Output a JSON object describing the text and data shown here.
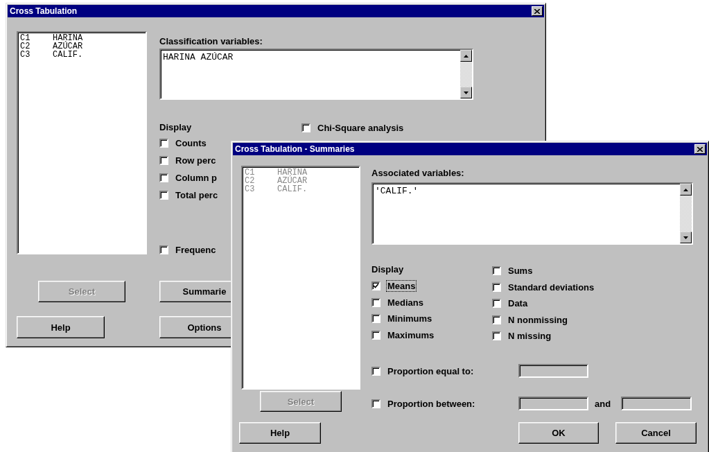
{
  "cross_tabulation": {
    "title": "Cross Tabulation",
    "variables": {
      "disabled": false,
      "items": [
        {
          "column": "C1",
          "name": "HARINA"
        },
        {
          "column": "C2",
          "name": "AZÚCAR"
        },
        {
          "column": "C3",
          "name": "CALIF."
        }
      ]
    },
    "classification_label": "Classification variables:",
    "classification_value": "HARINA AZÚCAR",
    "display_label": "Display",
    "display_options": [
      {
        "label": "Counts",
        "checked": false
      },
      {
        "label": "Row perc",
        "checked": false
      },
      {
        "label": "Column p",
        "checked": false
      },
      {
        "label": "Total perc",
        "checked": false
      }
    ],
    "chi_square": {
      "label": "Chi-Square analysis",
      "checked": false
    },
    "frequencies": {
      "label": "Frequenc",
      "checked": false
    },
    "select_button": {
      "label": "Select",
      "disabled": true
    },
    "help_button": {
      "label": "Help",
      "disabled": false
    },
    "summaries_button": {
      "label": "Summarie",
      "disabled": false
    },
    "options_button": {
      "label": "Options",
      "disabled": false
    }
  },
  "summaries_dialog": {
    "title": "Cross Tabulation - Summaries",
    "variables": {
      "disabled": true,
      "items": [
        {
          "column": "C1",
          "name": "HARINA"
        },
        {
          "column": "C2",
          "name": "AZÚCAR"
        },
        {
          "column": "C3",
          "name": "CALIF."
        }
      ]
    },
    "associated_label": "Associated variables:",
    "associated_value": "'CALIF.'",
    "display_label": "Display",
    "display_left": [
      {
        "label": "Means",
        "checked": true,
        "focused": true
      },
      {
        "label": "Medians",
        "checked": false,
        "focused": false
      },
      {
        "label": "Minimums",
        "checked": false,
        "focused": false
      },
      {
        "label": "Maximums",
        "checked": false,
        "focused": false
      }
    ],
    "display_right": [
      {
        "label": "Sums",
        "checked": false,
        "focused": false
      },
      {
        "label": "Standard deviations",
        "checked": false,
        "focused": false
      },
      {
        "label": "Data",
        "checked": false,
        "focused": false
      },
      {
        "label": "N nonmissing",
        "checked": false,
        "focused": false
      },
      {
        "label": "N missing",
        "checked": false,
        "focused": false
      }
    ],
    "proportion_equal": {
      "label": "Proportion equal to:",
      "checked": false
    },
    "proportion_between": {
      "label": "Proportion between:",
      "checked": false,
      "and_label": "and"
    },
    "select_button": {
      "label": "Select",
      "disabled": true
    },
    "help_button": {
      "label": "Help",
      "disabled": false
    },
    "ok_button": {
      "label": "OK",
      "disabled": false
    },
    "cancel_button": {
      "label": "Cancel",
      "disabled": false
    }
  }
}
